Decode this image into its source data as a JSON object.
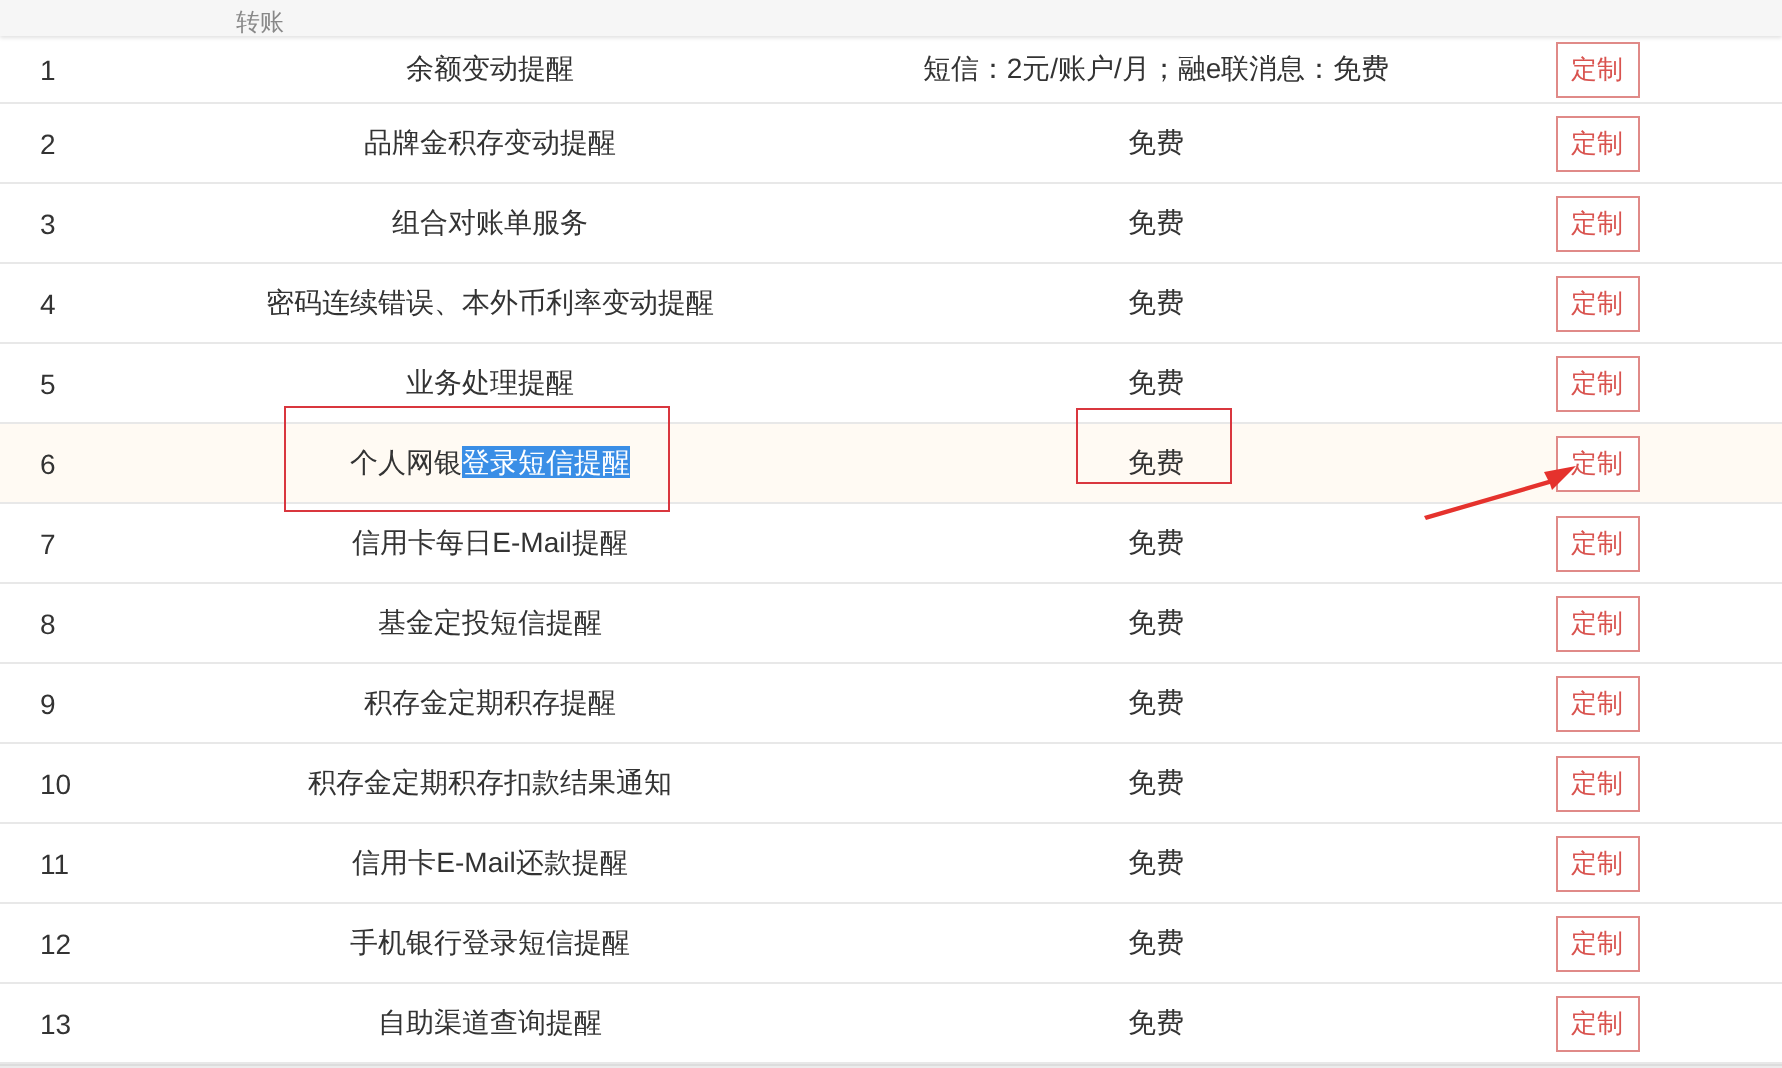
{
  "header": {
    "label": "转账"
  },
  "rows": [
    {
      "number": "1",
      "name": [
        {
          "text": "余额变动提醒",
          "selected": false
        }
      ],
      "fee": "短信：2元/账户/月；融e联消息：免费",
      "button": "定制",
      "hovered": false,
      "marked": false
    },
    {
      "number": "2",
      "name": [
        {
          "text": "品牌金积存变动提醒",
          "selected": false
        }
      ],
      "fee": "免费",
      "button": "定制",
      "hovered": false,
      "marked": false
    },
    {
      "number": "3",
      "name": [
        {
          "text": "组合对账单服务",
          "selected": false
        }
      ],
      "fee": "免费",
      "button": "定制",
      "hovered": false,
      "marked": false
    },
    {
      "number": "4",
      "name": [
        {
          "text": "密码连续错误、本外币利率变动提醒",
          "selected": false
        }
      ],
      "fee": "免费",
      "button": "定制",
      "hovered": false,
      "marked": false
    },
    {
      "number": "5",
      "name": [
        {
          "text": "业务处理提醒",
          "selected": false
        }
      ],
      "fee": "免费",
      "button": "定制",
      "hovered": false,
      "marked": false
    },
    {
      "number": "6",
      "name": [
        {
          "text": "个人网银",
          "selected": false
        },
        {
          "text": "登录短信提醒",
          "selected": true
        }
      ],
      "fee": "免费",
      "button": "定制",
      "hovered": true,
      "marked": true
    },
    {
      "number": "7",
      "name": [
        {
          "text": "信用卡每日E-Mail提醒",
          "selected": false
        }
      ],
      "fee": "免费",
      "button": "定制",
      "hovered": false,
      "marked": false
    },
    {
      "number": "8",
      "name": [
        {
          "text": "基金定投短信提醒",
          "selected": false
        }
      ],
      "fee": "免费",
      "button": "定制",
      "hovered": false,
      "marked": false
    },
    {
      "number": "9",
      "name": [
        {
          "text": "积存金定期积存提醒",
          "selected": false
        }
      ],
      "fee": "免费",
      "button": "定制",
      "hovered": false,
      "marked": false
    },
    {
      "number": "10",
      "name": [
        {
          "text": "积存金定期积存扣款结果通知",
          "selected": false
        }
      ],
      "fee": "免费",
      "button": "定制",
      "hovered": false,
      "marked": false
    },
    {
      "number": "11",
      "name": [
        {
          "text": "信用卡E-Mail还款提醒",
          "selected": false
        }
      ],
      "fee": "免费",
      "button": "定制",
      "hovered": false,
      "marked": false
    },
    {
      "number": "12",
      "name": [
        {
          "text": "手机银行登录短信提醒",
          "selected": false
        }
      ],
      "fee": "免费",
      "button": "定制",
      "hovered": false,
      "marked": false
    },
    {
      "number": "13",
      "name": [
        {
          "text": "自助渠道查询提醒",
          "selected": false
        }
      ],
      "fee": "免费",
      "button": "定制",
      "hovered": false,
      "marked": false
    }
  ]
}
